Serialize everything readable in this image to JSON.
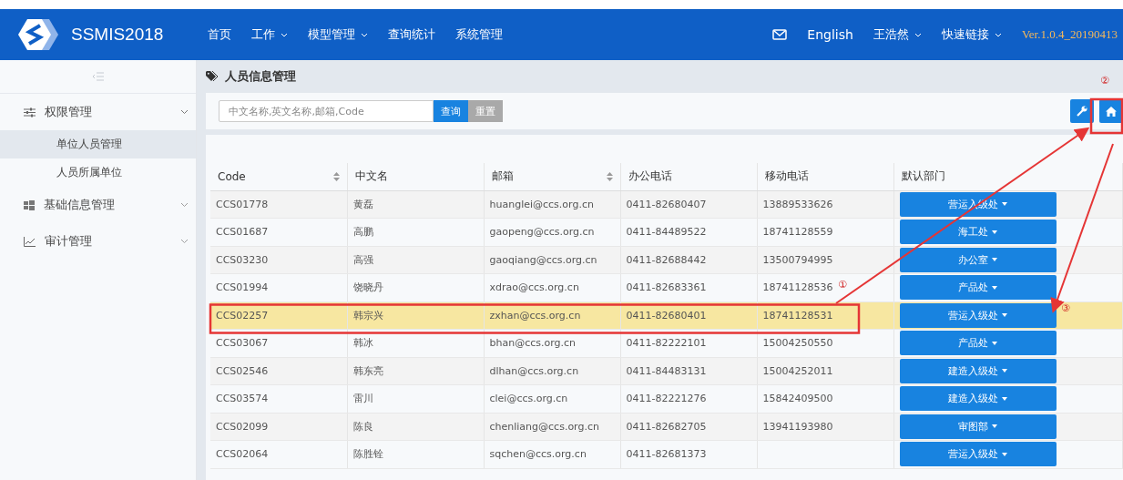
{
  "header": {
    "logo": "SSMIS2018",
    "nav": [
      {
        "label": "首页",
        "dropdown": false
      },
      {
        "label": "工作",
        "dropdown": true
      },
      {
        "label": "模型管理",
        "dropdown": true
      },
      {
        "label": "查询统计",
        "dropdown": false
      },
      {
        "label": "系统管理",
        "dropdown": false
      }
    ],
    "right": [
      {
        "kind": "mail"
      },
      {
        "kind": "text",
        "label": "English",
        "dropdown": false
      },
      {
        "kind": "text",
        "label": "王浩然",
        "dropdown": true
      },
      {
        "kind": "text",
        "label": "快速链接",
        "dropdown": true
      },
      {
        "kind": "version",
        "label": "Ver.1.0.4_20190413"
      }
    ]
  },
  "sidebar": {
    "items": [
      {
        "label": "权限管理",
        "expanded": true,
        "children": [
          {
            "label": "单位人员管理",
            "selected": true
          },
          {
            "label": "人员所属单位",
            "selected": false
          }
        ]
      },
      {
        "label": "基础信息管理",
        "expanded": false
      },
      {
        "label": "审计管理",
        "expanded": false
      }
    ]
  },
  "breadcrumb": "人员信息管理",
  "search": {
    "placeholder": "中文名称,英文名称,邮箱,Code",
    "query_button": "查询",
    "reset_button": "重置",
    "reset_disabled": true
  },
  "table": {
    "columns": [
      {
        "label": "Code",
        "sortable": true
      },
      {
        "label": "中文名",
        "sortable": false
      },
      {
        "label": "邮箱",
        "sortable": true
      },
      {
        "label": "办公电话",
        "sortable": false
      },
      {
        "label": "移动电话",
        "sortable": false
      },
      {
        "label": "默认部门",
        "sortable": false
      }
    ],
    "rows": [
      {
        "code": "CCS01778",
        "name": "黄磊",
        "email": "huanglei@ccs.org.cn",
        "office": "0411-82680407",
        "mobile": "13889533626",
        "dept": "营运入级处",
        "selected": false
      },
      {
        "code": "CCS01687",
        "name": "高鹏",
        "email": "gaopeng@ccs.org.cn",
        "office": "0411-84489522",
        "mobile": "18741128559",
        "dept": "海工处",
        "selected": false
      },
      {
        "code": "CCS03230",
        "name": "高强",
        "email": "gaoqiang@ccs.org.cn",
        "office": "0411-82688442",
        "mobile": "13500794995",
        "dept": "办公室",
        "selected": false
      },
      {
        "code": "CCS01994",
        "name": "饶晓丹",
        "email": "xdrao@ccs.org.cn",
        "office": "0411-82683361",
        "mobile": "18741128536",
        "dept": "产品处",
        "selected": false
      },
      {
        "code": "CCS02257",
        "name": "韩宗兴",
        "email": "zxhan@ccs.org.cn",
        "office": "0411-82680401",
        "mobile": "18741128531",
        "dept": "营运入级处",
        "selected": true
      },
      {
        "code": "CCS03067",
        "name": "韩冰",
        "email": "bhan@ccs.org.cn",
        "office": "0411-82222101",
        "mobile": "15004250550",
        "dept": "产品处",
        "selected": false
      },
      {
        "code": "CCS02546",
        "name": "韩东亮",
        "email": "dlhan@ccs.org.cn",
        "office": "0411-84483131",
        "mobile": "15004252011",
        "dept": "建造入级处",
        "selected": false
      },
      {
        "code": "CCS03574",
        "name": "雷川",
        "email": "clei@ccs.org.cn",
        "office": "0411-82221276",
        "mobile": "15842409500",
        "dept": "建造入级处",
        "selected": false
      },
      {
        "code": "CCS02099",
        "name": "陈良",
        "email": "chenliang@ccs.org.cn",
        "office": "0411-82682705",
        "mobile": "13941193980",
        "dept": "审图部",
        "selected": false
      },
      {
        "code": "CCS02064",
        "name": "陈胜铨",
        "email": "sqchen@ccs.org.cn",
        "office": "0411-82681373",
        "dept": "营运入级处",
        "selected": false
      }
    ]
  },
  "annotations": [
    "①",
    "②",
    "③"
  ]
}
